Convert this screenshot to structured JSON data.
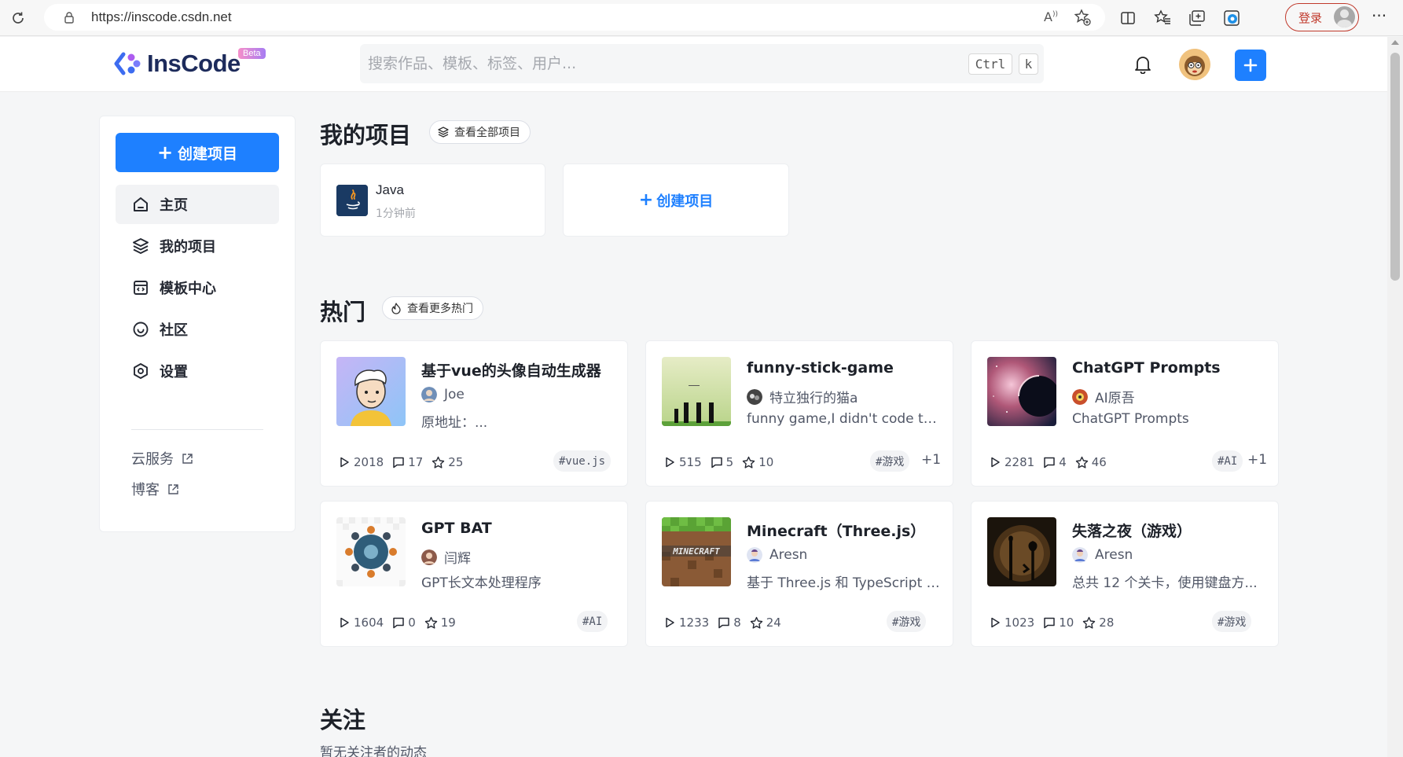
{
  "browser": {
    "url": "https://inscode.csdn.net",
    "login_label": "登录"
  },
  "header": {
    "logo_text": "InsCode",
    "beta_label": "Beta",
    "search_placeholder": "搜索作品、模板、标签、用户...",
    "shortcut_ctrl": "Ctrl",
    "shortcut_key": "k"
  },
  "sidebar": {
    "create_label": "创建项目",
    "items": [
      {
        "label": "主页",
        "icon": "home-icon"
      },
      {
        "label": "我的项目",
        "icon": "layers-icon"
      },
      {
        "label": "模板中心",
        "icon": "template-icon"
      },
      {
        "label": "社区",
        "icon": "community-icon"
      },
      {
        "label": "设置",
        "icon": "settings-icon"
      }
    ],
    "links": [
      {
        "label": "云服务"
      },
      {
        "label": "博客"
      }
    ]
  },
  "my_projects": {
    "title": "我的项目",
    "view_all_label": "查看全部项目",
    "project": {
      "name": "Java",
      "time": "1分钟前"
    },
    "create_label": "创建项目"
  },
  "hot": {
    "title": "热门",
    "view_more_label": "查看更多热门",
    "cards": [
      {
        "title": "基于vue的头像自动生成器",
        "author": "Joe",
        "desc": "原地址：...",
        "runs": "2018",
        "comments": "17",
        "stars": "25",
        "tag": "#vue.js",
        "more": ""
      },
      {
        "title": "funny-stick-game",
        "author": "特立独行的猫a",
        "desc": "funny game,I didn't code this...",
        "runs": "515",
        "comments": "5",
        "stars": "10",
        "tag": "#游戏",
        "more": "+1"
      },
      {
        "title": "ChatGPT Prompts",
        "author": "AI原吾",
        "desc": "ChatGPT Prompts",
        "runs": "2281",
        "comments": "4",
        "stars": "46",
        "tag": "#AI",
        "more": "+1"
      },
      {
        "title": "GPT BAT",
        "author": "闫辉",
        "desc": "GPT长文本处理程序",
        "runs": "1604",
        "comments": "0",
        "stars": "19",
        "tag": "#AI",
        "more": ""
      },
      {
        "title": "Minecraft（Three.js）",
        "author": "Aresn",
        "desc": "基于 Three.js 和 TypeScript 的...",
        "runs": "1233",
        "comments": "8",
        "stars": "24",
        "tag": "#游戏",
        "more": ""
      },
      {
        "title": "失落之夜（游戏）",
        "author": "Aresn",
        "desc": "总共 12 个关卡，使用键盘方...",
        "runs": "1023",
        "comments": "10",
        "stars": "28",
        "tag": "#游戏",
        "more": ""
      }
    ]
  },
  "follow": {
    "title": "关注",
    "empty": "暂无关注者的动态"
  },
  "colors": {
    "accent": "#1e80ff",
    "login_border": "#c0392b"
  }
}
